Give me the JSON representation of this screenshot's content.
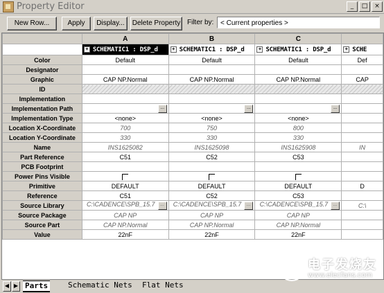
{
  "window": {
    "title": "Property Editor"
  },
  "toolbar": {
    "new_row": "New Row...",
    "apply": "Apply",
    "display": "Display...",
    "delete_property": "Delete Property",
    "filter_label": "Filter by:",
    "filter_value": "< Current properties >"
  },
  "grid": {
    "col_letters": [
      "A",
      "B",
      "C",
      ""
    ],
    "col_headers": [
      "SCHEMATIC1 : DSP_d",
      "SCHEMATIC1 : DSP_d",
      "SCHEMATIC1 : DSP_d",
      "SCHE"
    ],
    "rows": [
      {
        "name": "Color",
        "cells": [
          "Default",
          "Default",
          "Default",
          "Def"
        ]
      },
      {
        "name": "Designator",
        "cells": [
          "",
          "",
          "",
          ""
        ]
      },
      {
        "name": "Graphic",
        "cells": [
          "CAP NP.Normal",
          "CAP NP.Normal",
          "CAP NP.Normal",
          "CAP"
        ]
      },
      {
        "name": "ID",
        "cells": [
          "",
          "",
          "",
          ""
        ]
      },
      {
        "name": "Implementation",
        "cells": [
          "",
          "",
          "",
          ""
        ]
      },
      {
        "name": "Implementation Path",
        "cells": [
          "",
          "",
          "",
          ""
        ]
      },
      {
        "name": "Implementation Type",
        "cells": [
          "<none>",
          "<none>",
          "<none>",
          ""
        ]
      },
      {
        "name": "Location X-Coordinate",
        "cells": [
          "700",
          "750",
          "800",
          ""
        ]
      },
      {
        "name": "Location Y-Coordinate",
        "cells": [
          "330",
          "330",
          "330",
          ""
        ]
      },
      {
        "name": "Name",
        "cells": [
          "INS1625082",
          "INS1625098",
          "INS1625908",
          "IN"
        ]
      },
      {
        "name": "Part Reference",
        "cells": [
          "C51",
          "C52",
          "C53",
          ""
        ]
      },
      {
        "name": "PCB Footprint",
        "cells": [
          "",
          "",
          "",
          ""
        ]
      },
      {
        "name": "Power Pins Visible",
        "cells": [
          "",
          "",
          "",
          ""
        ]
      },
      {
        "name": "Primitive",
        "cells": [
          "DEFAULT",
          "DEFAULT",
          "DEFAULT",
          "D"
        ]
      },
      {
        "name": "Reference",
        "cells": [
          "C51",
          "C52",
          "C53",
          ""
        ]
      },
      {
        "name": "Source Library",
        "cells": [
          "C:\\CADENCE\\SPB_15.7",
          "C:\\CADENCE\\SPB_15.7",
          "C:\\CADENCE\\SPB_15.7",
          "C:\\"
        ]
      },
      {
        "name": "Source Package",
        "cells": [
          "CAP NP",
          "CAP NP",
          "CAP NP",
          ""
        ]
      },
      {
        "name": "Source Part",
        "cells": [
          "CAP NP.Normal",
          "CAP NP.Normal",
          "CAP NP.Normal",
          ""
        ]
      },
      {
        "name": "Value",
        "cells": [
          "22nF",
          "22nF",
          "22nF",
          ""
        ]
      }
    ]
  },
  "tabs": [
    "Parts",
    "Schematic Nets",
    "Flat Nets"
  ],
  "watermark": {
    "line1": "电子发烧友",
    "line2": "www.elecfans.com"
  }
}
